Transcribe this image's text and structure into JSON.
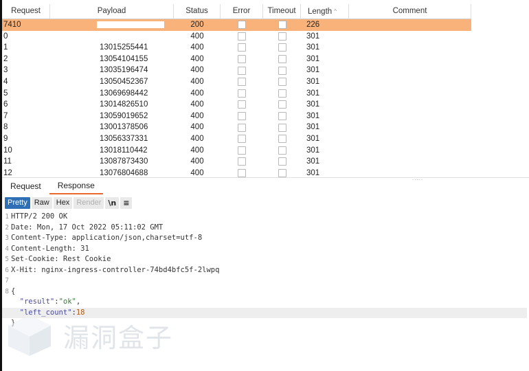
{
  "table": {
    "columns": [
      "Request",
      "Payload",
      "Status",
      "Error",
      "Timeout",
      "Length",
      "Comment"
    ],
    "sort_indicator": "^",
    "rows": [
      {
        "request": "7410",
        "payload": "",
        "status": "200",
        "length": "226",
        "selected": true
      },
      {
        "request": "0",
        "payload": "",
        "status": "400",
        "length": "301"
      },
      {
        "request": "1",
        "payload": "13015255441",
        "status": "400",
        "length": "301"
      },
      {
        "request": "2",
        "payload": "13054104155",
        "status": "400",
        "length": "301"
      },
      {
        "request": "3",
        "payload": "13035196474",
        "status": "400",
        "length": "301"
      },
      {
        "request": "4",
        "payload": "13050452367",
        "status": "400",
        "length": "301"
      },
      {
        "request": "5",
        "payload": "13069698442",
        "status": "400",
        "length": "301"
      },
      {
        "request": "6",
        "payload": "13014826510",
        "status": "400",
        "length": "301"
      },
      {
        "request": "7",
        "payload": "13059019652",
        "status": "400",
        "length": "301"
      },
      {
        "request": "8",
        "payload": "13001378506",
        "status": "400",
        "length": "301"
      },
      {
        "request": "9",
        "payload": "13056337331",
        "status": "400",
        "length": "301"
      },
      {
        "request": "10",
        "payload": "13018110442",
        "status": "400",
        "length": "301"
      },
      {
        "request": "11",
        "payload": "13087873430",
        "status": "400",
        "length": "301"
      },
      {
        "request": "12",
        "payload": "13076804688",
        "status": "400",
        "length": "301"
      }
    ]
  },
  "tabs": {
    "request": "Request",
    "response": "Response"
  },
  "toolbar": {
    "pretty": "Pretty",
    "raw": "Raw",
    "hex": "Hex",
    "render": "Render",
    "newline": "\\n",
    "menu": "≡"
  },
  "response": {
    "line1": "HTTP/2 200 OK",
    "line2": "Date: Mon, 17 Oct 2022 05:11:02 GMT",
    "line3": "Content-Type: application/json,charset=utf-8",
    "line4": "Content-Length: 31",
    "line5": "Set-Cookie: Rest Cookie",
    "line6": "X-Hit: nginx-ingress-controller-74bd4bfc5f-2lwpq",
    "line7": "",
    "line8": "{",
    "line9_key": "\"result\"",
    "line9_val": "\"ok\"",
    "line10_key": "\"left_count\"",
    "line10_val": "18",
    "line11": "}"
  },
  "watermark": "漏洞盒子",
  "colors": {
    "selected_row": "#f9b27a",
    "active_tab": "#e8692a",
    "pretty_button": "#2f6fb5"
  }
}
